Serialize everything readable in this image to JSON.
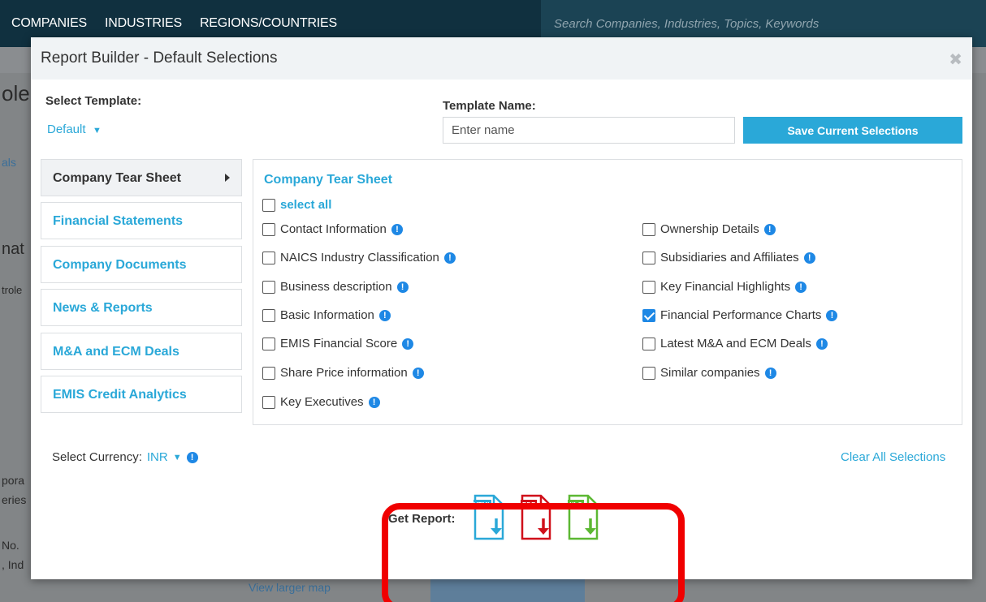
{
  "topnav": {
    "links": [
      "COMPANIES",
      "INDUSTRIES",
      "REGIONS/COUNTRIES"
    ],
    "search_placeholder": "Search Companies, Industries, Topics, Keywords"
  },
  "background": {
    "fragments": [
      "ole",
      "als",
      "nat",
      "trole",
      "pora",
      "eries",
      "No.",
      ", Ind"
    ],
    "map_link": "View larger map"
  },
  "modal": {
    "title": "Report Builder - Default Selections",
    "close_glyph": "✖",
    "select_template_label": "Select Template:",
    "template_value": "Default",
    "template_name_label": "Template Name:",
    "template_name_placeholder": "Enter name",
    "save_button": "Save Current Selections",
    "menu": [
      {
        "label": "Company Tear Sheet",
        "active": true
      },
      {
        "label": "Financial Statements",
        "active": false
      },
      {
        "label": "Company Documents",
        "active": false
      },
      {
        "label": "News & Reports",
        "active": false
      },
      {
        "label": "M&A and ECM Deals",
        "active": false
      },
      {
        "label": "EMIS Credit Analytics",
        "active": false
      }
    ],
    "panel": {
      "title": "Company Tear Sheet",
      "select_all": "select all",
      "left_options": [
        {
          "label": "Contact Information",
          "checked": false
        },
        {
          "label": "NAICS Industry Classification",
          "checked": false
        },
        {
          "label": "Business description",
          "checked": false
        },
        {
          "label": "Basic Information",
          "checked": false
        },
        {
          "label": "EMIS Financial Score",
          "checked": false
        },
        {
          "label": "Share Price information",
          "checked": false
        },
        {
          "label": "Key Executives",
          "checked": false
        }
      ],
      "right_options": [
        {
          "label": "Ownership Details",
          "checked": false
        },
        {
          "label": "Subsidiaries and Affiliates",
          "checked": false
        },
        {
          "label": "Key Financial Highlights",
          "checked": false
        },
        {
          "label": "Financial Performance Charts",
          "checked": true
        },
        {
          "label": "Latest M&A and ECM Deals",
          "checked": false
        },
        {
          "label": "Similar companies",
          "checked": false
        }
      ]
    },
    "currency_label": "Select Currency:",
    "currency_value": "INR",
    "clear_all": "Clear All Selections",
    "get_report_label": "Get Report:",
    "formats": [
      {
        "tag": "HTML",
        "color": "#2aa8d8"
      },
      {
        "tag": "PDF",
        "color": "#d0101a"
      },
      {
        "tag": "XLS",
        "color": "#5cb833"
      }
    ],
    "highlight_color": "#f00000"
  }
}
